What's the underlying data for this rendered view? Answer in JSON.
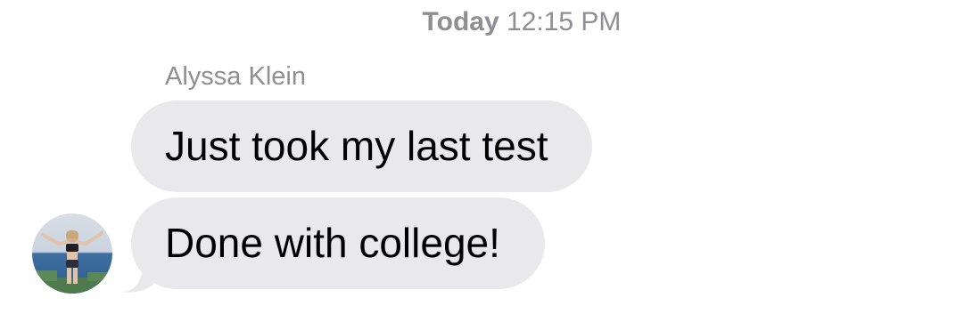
{
  "conversation": {
    "timestamp_day": "Today",
    "timestamp_time": "12:15 PM",
    "sender_name": "Alyssa Klein",
    "messages": [
      {
        "text": "Just took my last test"
      },
      {
        "text": "Done with college!"
      }
    ],
    "avatar_icon": "person-photo-avatar",
    "colors": {
      "incoming_bubble": "#e9e9eb",
      "meta_text": "#8e8e93",
      "message_text": "#000000"
    }
  }
}
